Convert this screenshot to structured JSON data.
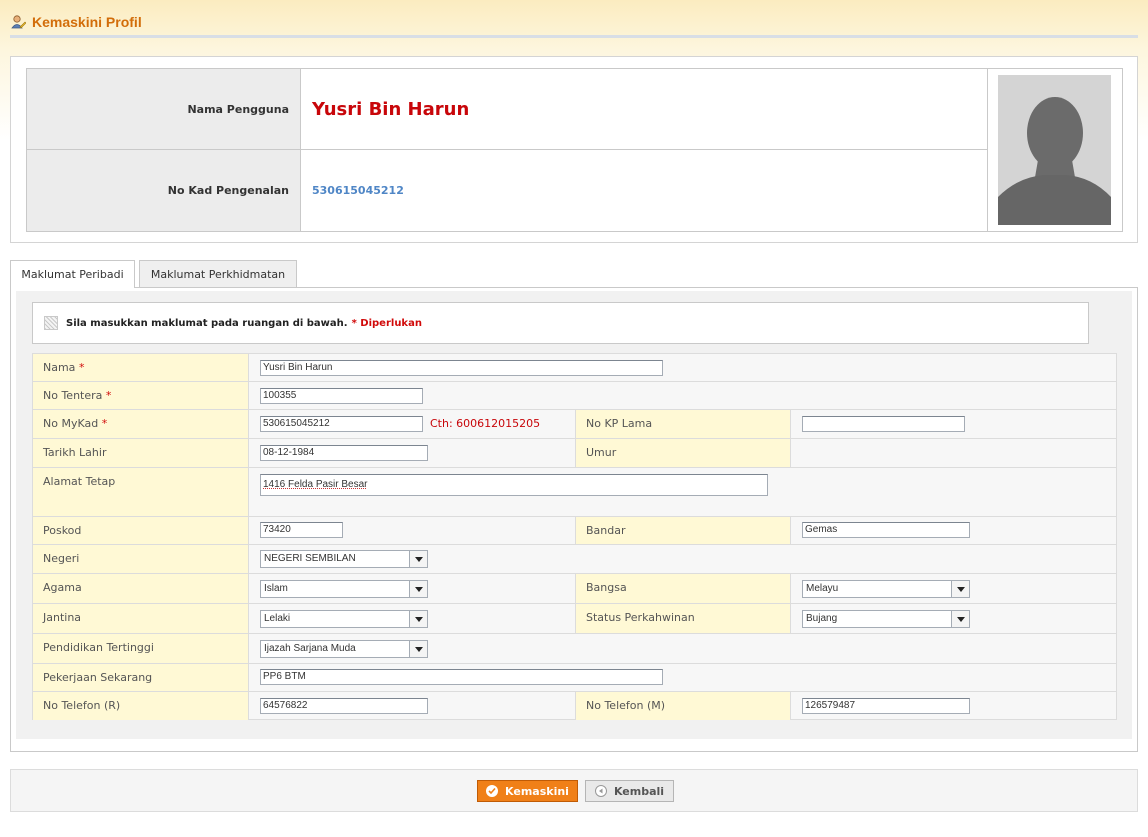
{
  "header": {
    "title": "Kemaskini Profil",
    "icon": "user-edit-icon"
  },
  "profile": {
    "name_label": "Nama Pengguna",
    "name_value": "Yusri Bin Harun",
    "ic_label": "No Kad Pengenalan",
    "ic_value": "530615045212",
    "photo": "avatar-silhouette"
  },
  "tabs": [
    {
      "label": "Maklumat Peribadi",
      "active": true
    },
    {
      "label": "Maklumat Perkhidmatan",
      "active": false
    }
  ],
  "notice": {
    "text": "Sila masukkan maklumat pada ruangan di bawah.",
    "required": "* Diperlukan"
  },
  "form": {
    "nama": {
      "label": "Nama",
      "star": "*",
      "value": "Yusri Bin Harun"
    },
    "no_tentera": {
      "label": "No Tentera",
      "star": "*",
      "value": "100355"
    },
    "no_mykad": {
      "label": "No MyKad",
      "star": "*",
      "value": "530615045212",
      "hint": "Cth: 600612015205"
    },
    "no_kp_lama": {
      "label": "No KP Lama",
      "value": ""
    },
    "tarikh_lahir": {
      "label": "Tarikh Lahir",
      "value": "08-12-1984"
    },
    "umur": {
      "label": "Umur",
      "value": ""
    },
    "alamat_tetap": {
      "label": "Alamat Tetap",
      "value": "1416 Felda Pasir Besar"
    },
    "poskod": {
      "label": "Poskod",
      "value": "73420"
    },
    "bandar": {
      "label": "Bandar",
      "value": "Gemas"
    },
    "negeri": {
      "label": "Negeri",
      "value": "NEGERI SEMBILAN"
    },
    "agama": {
      "label": "Agama",
      "value": "Islam"
    },
    "bangsa": {
      "label": "Bangsa",
      "value": "Melayu"
    },
    "jantina": {
      "label": "Jantina",
      "value": "Lelaki"
    },
    "status_perkahwinan": {
      "label": "Status Perkahwinan",
      "value": "Bujang"
    },
    "pendidikan": {
      "label": "Pendidikan Tertinggi",
      "value": "Ijazah Sarjana Muda"
    },
    "pekerjaan": {
      "label": "Pekerjaan Sekarang",
      "value": "PP6 BTM"
    },
    "telefon_r": {
      "label": "No Telefon (R)",
      "value": "64576822"
    },
    "telefon_m": {
      "label": "No Telefon (M)",
      "value": "126579487"
    }
  },
  "buttons": {
    "save": "Kemaskini",
    "back": "Kembali"
  },
  "colors": {
    "accent": "#d26d0a",
    "name": "#c8060a",
    "ic": "#4f86c6",
    "label_bg": "#fff9d5",
    "button": "#f08018"
  }
}
